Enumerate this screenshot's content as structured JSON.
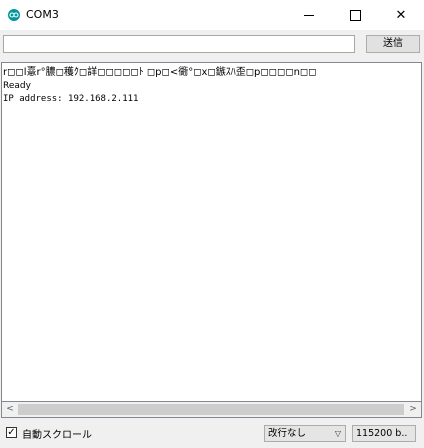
{
  "window": {
    "title": "COM3",
    "icon": "arduino-icon",
    "minimize_glyph": "",
    "close_glyph": "✕"
  },
  "send_bar": {
    "input_value": "",
    "send_label": "送信"
  },
  "output": {
    "lines": [
      "r◻◻l憙r°膿◻穫ｸ◻詳◻◻◻◻◻ﾄ ◻p◻<衚°◻x◻鏃ｽﾊ歪◻p◻◻◻◻n◻◻",
      "Ready",
      "IP address: 192.168.2.111"
    ]
  },
  "scrollbar": {
    "left_arrow": "<",
    "right_arrow": ">"
  },
  "footer": {
    "autoscroll_label": "自動スクロール",
    "autoscroll_checked": true,
    "check_glyph": "✓",
    "line_ending": "改行なし",
    "baud_rate": "115200 b.."
  },
  "colors": {
    "accent": "#00979c"
  }
}
